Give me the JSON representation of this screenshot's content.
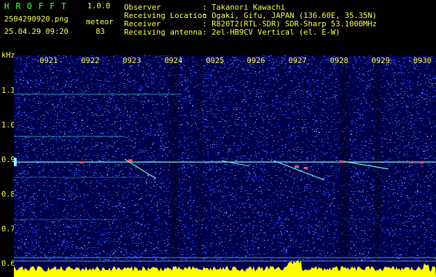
{
  "app": {
    "title": "H R O F F T",
    "version": "1.0.0"
  },
  "file": {
    "name": "2504290920.png",
    "datetime": "25.04.29 09:20"
  },
  "counter": {
    "label": "meteor",
    "value": "83"
  },
  "info": [
    {
      "key": "Observer",
      "value": ": Takanori Kawachi"
    },
    {
      "key": "Receiving Location",
      "value": ": Ogaki, Gifu, JAPAN (136.60E, 35.35N)"
    },
    {
      "key": "Receiver",
      "value": ": R820T2(RTL-SDR) SDR-Sharp 53.1000MHz"
    },
    {
      "key": "Receiving antenna",
      "value": ": 2el-HB9CV Vertical (el. E-W)"
    }
  ],
  "axis": {
    "unit": "kHz",
    "freq_ticks": [
      "1.1",
      "1.0",
      "0.9",
      "0.8",
      "0.7",
      "0.6"
    ],
    "time_ticks": [
      "0921",
      "0922",
      "0923",
      "0924",
      "0925",
      "0926",
      "0927",
      "0928",
      "0929",
      "0930"
    ]
  },
  "colors": {
    "background": "#00004a",
    "trace": "#7fffff",
    "header_green": "#4cff4c",
    "header_yellow": "#ffff55"
  }
}
